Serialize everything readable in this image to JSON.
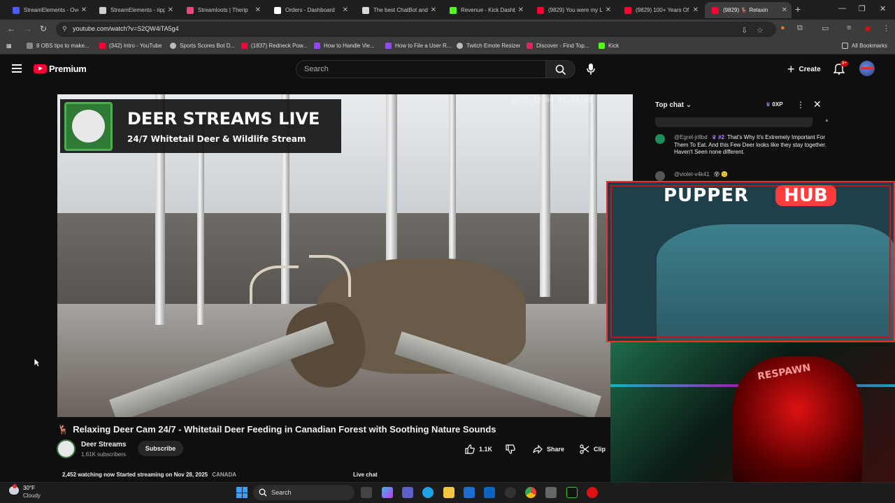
{
  "browser": {
    "tabs": [
      {
        "title": "StreamElements - Ove",
        "color": "#4b5bff"
      },
      {
        "title": "StreamElements - ripp",
        "color": "#cfcfcf"
      },
      {
        "title": "Streamloots | Therip",
        "color": "#e84a7a"
      },
      {
        "title": "Orders - Dashboard",
        "color": "#ffffff"
      },
      {
        "title": "The best ChatBot and",
        "color": "#d9d9d9"
      },
      {
        "title": "Revenue - Kick Dashb",
        "color": "#53fc18"
      },
      {
        "title": "(9829) You were my L",
        "color": "#ff0033"
      },
      {
        "title": "(9829) 100+ Years Of",
        "color": "#ff0033"
      },
      {
        "title": "(9829) 🦌 Relaxin",
        "color": "#ff0033"
      }
    ],
    "url": "youtube.com/watch?v=S2QW4iTA5g4",
    "bookmarks": [
      {
        "label": "8 OBS tips to make...",
        "color": "#888888"
      },
      {
        "label": "(342) Intro - YouTube",
        "color": "#ff0033"
      },
      {
        "label": "Sports Scores Bot D...",
        "color": "#bbbbbb"
      },
      {
        "label": "(1837) Redneck Pow...",
        "color": "#ff0033"
      },
      {
        "label": "How to Handle Vie...",
        "color": "#9147ff"
      },
      {
        "label": "How to File a User R...",
        "color": "#9147ff"
      },
      {
        "label": "Twitch Emote Resizer",
        "color": "#bbbbbb"
      },
      {
        "label": "Discover - Find Top...",
        "color": "#e0245e"
      },
      {
        "label": "Kick",
        "color": "#53fc18"
      }
    ],
    "all_bookmarks": "All Bookmarks"
  },
  "youtube": {
    "brand": "Premium",
    "search_placeholder": "Search",
    "create_label": "Create",
    "notif_count": "9+",
    "overlay": {
      "title": "DEER STREAMS LIVE",
      "subtitle": "24/7 Whitetail Deer & Wildlife Stream",
      "timestamp": "2025-12-04 01:13:42"
    },
    "video_title": "Relaxing Deer Cam 24/7 - Whitetail Deer Feeding in Canadian Forest with Soothing Nature Sounds",
    "video_title_emoji": "🦌",
    "channel_name": "Deer Streams",
    "subscribers": "1.61K subscribers",
    "subscribe_label": "Subscribe",
    "likes": "1.1K",
    "share_label": "Share",
    "clip_label": "Clip",
    "watching": "2,452 watching now",
    "started": "Started streaming on Nov 28, 2025",
    "country": "CANADA",
    "live_chat_label": "Live chat"
  },
  "chat": {
    "header": "Top chat",
    "xp": "0XP",
    "messages": [
      {
        "author": "@Egret-jr8bd",
        "rank": "#2",
        "text": "That's Why It's Extremely Important For Them To Eat. And this Few Deer looks like they stay together. Haven't Seen none different."
      },
      {
        "author": "@violet-v4k41",
        "rank": "",
        "text": "😵 🙂"
      }
    ]
  },
  "streamer": {
    "banner_left": "PUPPER",
    "banner_right": "HUB",
    "chair_text": "RESPAWN"
  },
  "taskbar": {
    "temp": "30°F",
    "weather": "Cloudy",
    "search_placeholder": "Search"
  }
}
